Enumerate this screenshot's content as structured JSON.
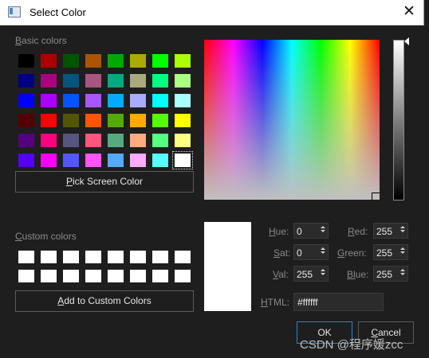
{
  "window": {
    "title": "Select Color",
    "close_glyph": "✕"
  },
  "basic_colors": {
    "label_prefix": "B",
    "label_rest": "asic colors",
    "swatches": [
      "#000000",
      "#aa0000",
      "#005500",
      "#aa5500",
      "#00aa00",
      "#aaaa00",
      "#00ff00",
      "#aaff00",
      "#00007f",
      "#aa007f",
      "#00557f",
      "#aa557f",
      "#00aa7f",
      "#aaaa7f",
      "#00ff7f",
      "#aaff7f",
      "#0000ff",
      "#aa00ff",
      "#0055ff",
      "#aa55ff",
      "#00aaff",
      "#aaaaff",
      "#00ffff",
      "#aaffff",
      "#550000",
      "#ff0000",
      "#555500",
      "#ff5500",
      "#55aa00",
      "#ffaa00",
      "#55ff00",
      "#ffff00",
      "#55007f",
      "#ff007f",
      "#55557f",
      "#ff557f",
      "#55aa7f",
      "#ffaa7f",
      "#55ff7f",
      "#ffff7f",
      "#5500ff",
      "#ff00ff",
      "#5555ff",
      "#ff55ff",
      "#55aaff",
      "#ffaaff",
      "#55ffff",
      "#ffffff"
    ],
    "selected_index": 47
  },
  "pick_screen": {
    "prefix": "P",
    "rest": "ick Screen Color"
  },
  "custom_colors": {
    "label_prefix": "C",
    "label_rest": "ustom colors",
    "swatches": [
      "#ffffff",
      "#ffffff",
      "#ffffff",
      "#ffffff",
      "#ffffff",
      "#ffffff",
      "#ffffff",
      "#ffffff",
      "#ffffff",
      "#ffffff",
      "#ffffff",
      "#ffffff",
      "#ffffff",
      "#ffffff",
      "#ffffff",
      "#ffffff"
    ]
  },
  "add_custom": {
    "prefix": "A",
    "rest": "dd to Custom Colors"
  },
  "fields": {
    "hue": {
      "prefix": "H",
      "rest": "ue:",
      "value": "0"
    },
    "sat": {
      "prefix": "S",
      "rest": "at:",
      "value": "0"
    },
    "val": {
      "prefix": "V",
      "rest": "al:",
      "value": "255"
    },
    "red": {
      "prefix": "R",
      "rest": "ed:",
      "value": "255"
    },
    "green": {
      "prefix": "G",
      "rest": "reen:",
      "value": "255"
    },
    "blue": {
      "prefix": "Bl",
      "rest": "ue:",
      "value": "255"
    },
    "html": {
      "prefix": "H",
      "rest": "TML:",
      "value": "#ffffff"
    }
  },
  "buttons": {
    "ok": "OK",
    "cancel_prefix": "C",
    "cancel_rest": "ancel"
  },
  "current_color": "#ffffff",
  "watermark": "CSDN @程序媛zcc"
}
